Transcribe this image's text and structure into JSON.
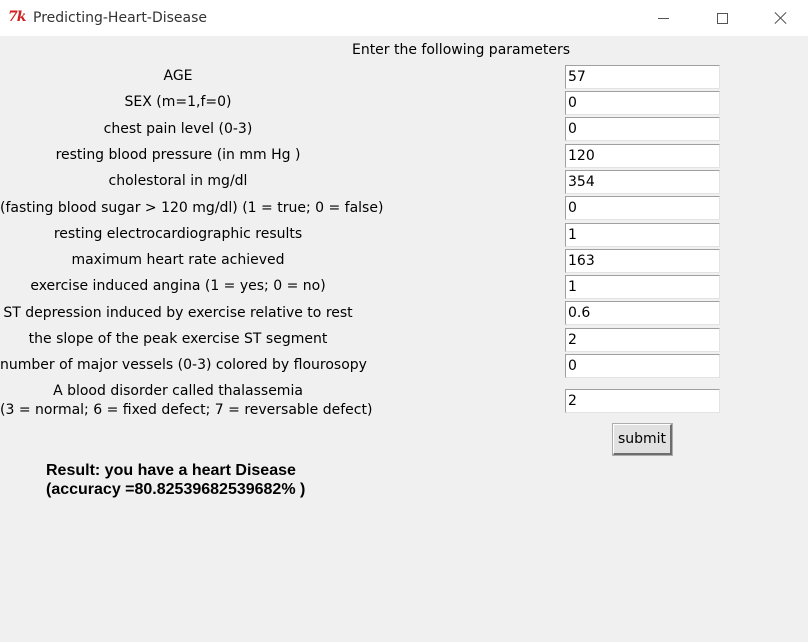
{
  "window": {
    "title": "Predicting-Heart-Disease",
    "icon": "tk-feather-icon",
    "icon_text": "7k"
  },
  "form": {
    "header": "Enter the following parameters",
    "fields": [
      {
        "label": "AGE",
        "value": "57"
      },
      {
        "label": "SEX (m=1,f=0)",
        "value": "0"
      },
      {
        "label": "chest pain level (0-3)",
        "value": "0"
      },
      {
        "label": "resting blood pressure  (in mm Hg )",
        "value": "120"
      },
      {
        "label": "cholestoral in mg/dl",
        "value": "354"
      },
      {
        "label": "(fasting blood sugar > 120 mg/dl) (1 = true; 0 = false)",
        "value": "0"
      },
      {
        "label": "resting electrocardiographic results",
        "value": "1"
      },
      {
        "label": "maximum heart rate achieved",
        "value": "163"
      },
      {
        "label": "exercise induced angina (1 = yes; 0 = no)",
        "value": "1"
      },
      {
        "label": "ST depression induced by exercise relative to rest",
        "value": "0.6"
      },
      {
        "label": "the slope of the peak exercise ST segment",
        "value": "2"
      },
      {
        "label": "number of major vessels (0-3) colored by flourosopy",
        "value": "0"
      },
      {
        "label_line1": "A blood disorder called thalassemia",
        "label_line2": "(3 = normal; 6 = fixed defect; 7 = reversable defect)",
        "value": "2"
      }
    ],
    "submit_label": "submit"
  },
  "result": {
    "line1": "Result: you have a heart Disease",
    "line2": "(accuracy =80.82539682539682% )"
  },
  "colors": {
    "background": "#f0f0f0",
    "titlebar": "#ffffff",
    "icon_red": "#d11f1f"
  }
}
